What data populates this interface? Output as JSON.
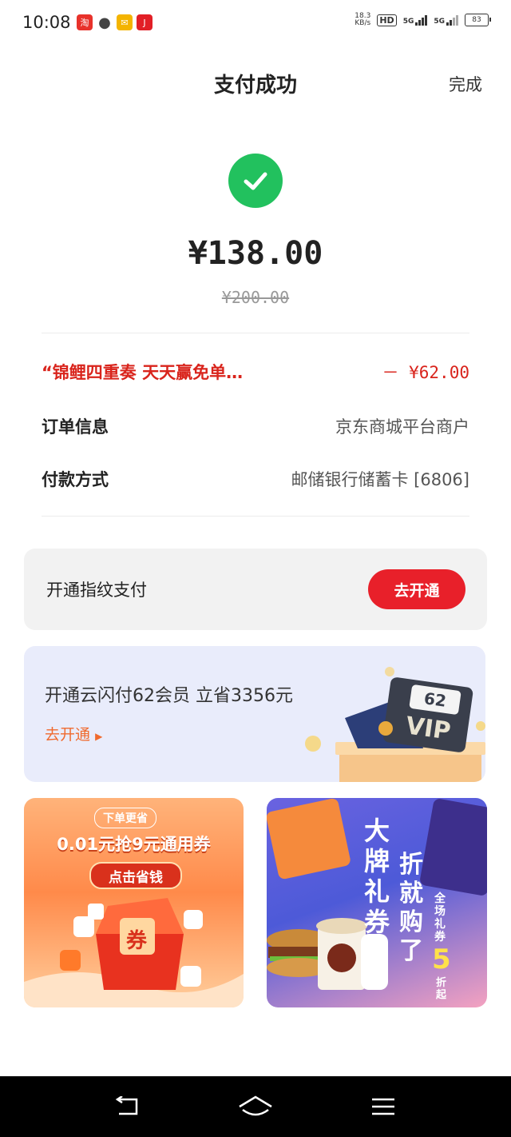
{
  "status_bar": {
    "time": "10:08",
    "speed": "18.3",
    "speed_unit": "KB/s",
    "hd": "HD",
    "net1": "5G",
    "net2": "5G",
    "battery": "83",
    "app_icons": [
      "taobao-icon",
      "message-icon",
      "mail-icon",
      "jd-icon"
    ]
  },
  "header": {
    "title": "支付成功",
    "done": "完成"
  },
  "payment": {
    "amount": "¥138.00",
    "original": "¥200.00",
    "success_color": "#22c15e"
  },
  "details": {
    "promo_label": "“锦鲤四重奏 天天赢免单…",
    "promo_value": "－ ¥62.00",
    "order_label": "订单信息",
    "order_value": "京东商城平台商户",
    "method_label": "付款方式",
    "method_value": "邮储银行储蓄卡 [6806]"
  },
  "fingerprint": {
    "text": "开通指纹支付",
    "button": "去开通",
    "button_color": "#e8202a"
  },
  "vip": {
    "title": "开通云闪付62会员 立省3356元",
    "link": "去开通",
    "badge_num": "62",
    "badge_text": "VIP"
  },
  "banners": {
    "left": {
      "tag": "下单更省",
      "headline": "0.01元抢9元通用券",
      "cta": "点击省钱",
      "box_text": "券"
    },
    "right": {
      "big": "大牌礼券",
      "sub": "折就购了",
      "side": "全场礼券",
      "num": "5",
      "unit": "折起"
    }
  },
  "nav": {
    "back": "back-icon",
    "home": "home-icon",
    "menu": "menu-icon"
  }
}
